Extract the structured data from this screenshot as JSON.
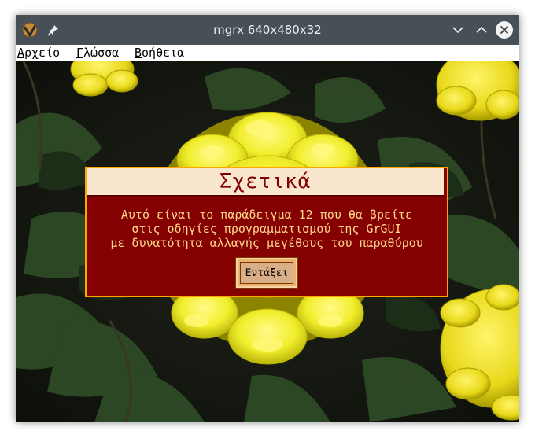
{
  "window": {
    "title": "mgrx 640x480x32",
    "app_icon": "mgrx-app-icon",
    "controls": [
      "pin-icon",
      "minimize-icon",
      "maximize-icon",
      "close-icon"
    ]
  },
  "menubar": {
    "items": [
      {
        "first": "Α",
        "rest": "ρχείο"
      },
      {
        "first": "Γ",
        "rest": "λώσσα"
      },
      {
        "first": "Β",
        "rest": "οήθεια"
      }
    ]
  },
  "dialog": {
    "title": "Σχετικά",
    "lines": [
      "Αυτό είναι το παράδειγμα 12 που θα βρείτε",
      "στις οδηγίες προγραμματισμού της GrGUI",
      "με δυνατότητα αλλαγής μεγέθους του παραθύρου"
    ],
    "ok_label": "Εντάξει"
  },
  "colors": {
    "dialog_bg": "#850000",
    "dialog_border": "#ffa400",
    "title_bg": "#f9e6cf",
    "text": "#ffd98a",
    "button": "#d9ae88"
  },
  "background_image": "yellow-chrysanthemum-photo"
}
